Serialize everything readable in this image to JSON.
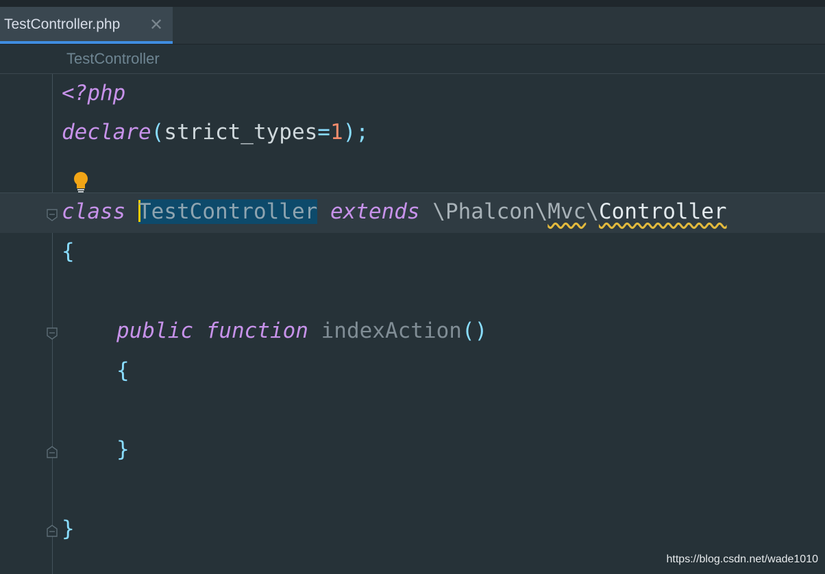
{
  "tab": {
    "label": "TestController.php",
    "close": "✕"
  },
  "breadcrumb": "TestController",
  "code": {
    "line1": "<?php",
    "line2": {
      "keyword": "declare",
      "open": "(",
      "arg": "strict_types",
      "eq": "=",
      "value": "1",
      "close": ");"
    },
    "class_line": {
      "keyword": "class",
      "name": "TestController",
      "extends": "extends",
      "ns1": "\\Phalcon\\",
      "ns2": "Mvc",
      "ns3": "\\",
      "parent": "Controller"
    },
    "open_brace": "{",
    "method_line": {
      "visibility": "public",
      "keyword": "function",
      "name": "indexAction",
      "parens": "()"
    },
    "method_open": "{",
    "method_close": "}",
    "close_brace": "}"
  },
  "watermark": "https://blog.csdn.net/wade1010",
  "icons": {
    "intention": "lightbulb-icon",
    "fold": "fold-marker-icon"
  },
  "colors": {
    "background": "#263238",
    "keyword": "#c792ea",
    "punctuation": "#89ddff",
    "number": "#f78c6c",
    "selection": "#0d4a6b",
    "tab_accent": "#3f8de0"
  }
}
